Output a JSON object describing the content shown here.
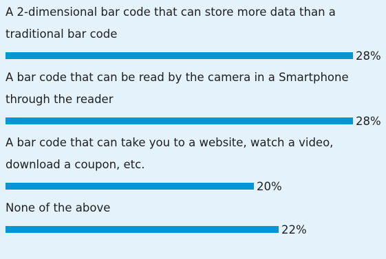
{
  "chart_data": {
    "type": "bar",
    "orientation": "horizontal",
    "categories": [
      "A 2-dimensional bar code that can store more data than a\ntraditional bar code",
      "A bar code that can be read by the camera in a Smartphone\nthrough the reader",
      "A bar code that can take you to a website, watch a video,\ndownload a coupon, etc.",
      "None of the above"
    ],
    "values": [
      28,
      28,
      20,
      22
    ],
    "value_labels": [
      "28%",
      "28%",
      "20%",
      "22%"
    ],
    "unit": "%",
    "xlim": [
      0,
      28
    ],
    "grid": false,
    "legend": "none",
    "colors": {
      "bar": "#0595d3",
      "background": "#e3f2fb",
      "text": "#1e1e1e"
    }
  }
}
